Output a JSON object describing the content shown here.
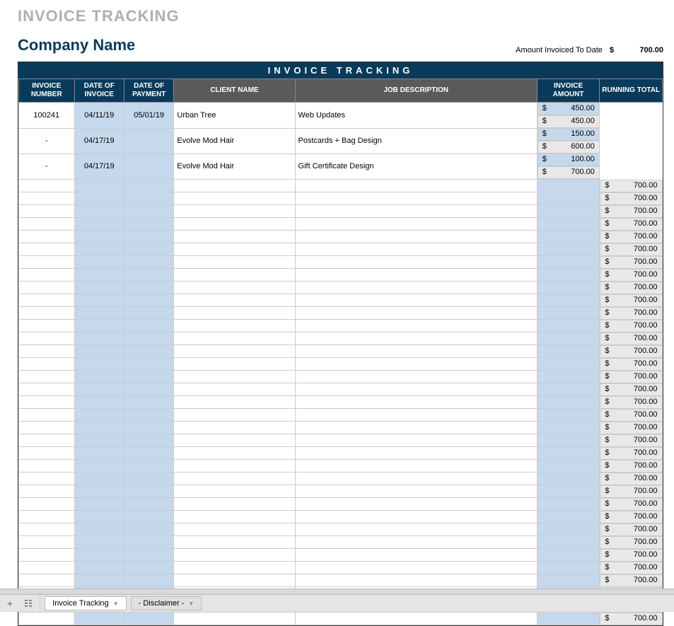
{
  "title": "INVOICE TRACKING",
  "company": "Company Name",
  "amount_invoiced_label": "Amount Invoiced To Date",
  "amount_currency": "$",
  "amount_value": "700.00",
  "banner": "INVOICE  TRACKING",
  "headers": {
    "invnum": "INVOICE NUMBER",
    "dinv": "DATE OF INVOICE",
    "dpay": "DATE OF PAYMENT",
    "client": "CLIENT NAME",
    "job": "JOB DESCRIPTION",
    "amount": "INVOICE AMOUNT",
    "running": "RUNNING TOTAL"
  },
  "rows": [
    {
      "invnum": "100241",
      "dinv": "04/11/19",
      "dpay": "05/01/19",
      "client": "Urban Tree",
      "job": "Web Updates",
      "amount": "450.00",
      "running": "450.00"
    },
    {
      "invnum": "-",
      "dinv": "04/17/19",
      "dpay": "",
      "client": "Evolve Mod Hair",
      "job": "Postcards + Bag Design",
      "amount": "150.00",
      "running": "600.00"
    },
    {
      "invnum": "-",
      "dinv": "04/17/19",
      "dpay": "",
      "client": "Evolve Mod Hair",
      "job": "Gift Certificate Design",
      "amount": "100.00",
      "running": "700.00"
    },
    {
      "invnum": "",
      "dinv": "",
      "dpay": "",
      "client": "",
      "job": "",
      "amount": "",
      "running": "700.00"
    },
    {
      "invnum": "",
      "dinv": "",
      "dpay": "",
      "client": "",
      "job": "",
      "amount": "",
      "running": "700.00"
    },
    {
      "invnum": "",
      "dinv": "",
      "dpay": "",
      "client": "",
      "job": "",
      "amount": "",
      "running": "700.00"
    },
    {
      "invnum": "",
      "dinv": "",
      "dpay": "",
      "client": "",
      "job": "",
      "amount": "",
      "running": "700.00"
    },
    {
      "invnum": "",
      "dinv": "",
      "dpay": "",
      "client": "",
      "job": "",
      "amount": "",
      "running": "700.00"
    },
    {
      "invnum": "",
      "dinv": "",
      "dpay": "",
      "client": "",
      "job": "",
      "amount": "",
      "running": "700.00"
    },
    {
      "invnum": "",
      "dinv": "",
      "dpay": "",
      "client": "",
      "job": "",
      "amount": "",
      "running": "700.00"
    },
    {
      "invnum": "",
      "dinv": "",
      "dpay": "",
      "client": "",
      "job": "",
      "amount": "",
      "running": "700.00"
    },
    {
      "invnum": "",
      "dinv": "",
      "dpay": "",
      "client": "",
      "job": "",
      "amount": "",
      "running": "700.00"
    },
    {
      "invnum": "",
      "dinv": "",
      "dpay": "",
      "client": "",
      "job": "",
      "amount": "",
      "running": "700.00"
    },
    {
      "invnum": "",
      "dinv": "",
      "dpay": "",
      "client": "",
      "job": "",
      "amount": "",
      "running": "700.00"
    },
    {
      "invnum": "",
      "dinv": "",
      "dpay": "",
      "client": "",
      "job": "",
      "amount": "",
      "running": "700.00"
    },
    {
      "invnum": "",
      "dinv": "",
      "dpay": "",
      "client": "",
      "job": "",
      "amount": "",
      "running": "700.00"
    },
    {
      "invnum": "",
      "dinv": "",
      "dpay": "",
      "client": "",
      "job": "",
      "amount": "",
      "running": "700.00"
    },
    {
      "invnum": "",
      "dinv": "",
      "dpay": "",
      "client": "",
      "job": "",
      "amount": "",
      "running": "700.00"
    },
    {
      "invnum": "",
      "dinv": "",
      "dpay": "",
      "client": "",
      "job": "",
      "amount": "",
      "running": "700.00"
    },
    {
      "invnum": "",
      "dinv": "",
      "dpay": "",
      "client": "",
      "job": "",
      "amount": "",
      "running": "700.00"
    },
    {
      "invnum": "",
      "dinv": "",
      "dpay": "",
      "client": "",
      "job": "",
      "amount": "",
      "running": "700.00"
    },
    {
      "invnum": "",
      "dinv": "",
      "dpay": "",
      "client": "",
      "job": "",
      "amount": "",
      "running": "700.00"
    },
    {
      "invnum": "",
      "dinv": "",
      "dpay": "",
      "client": "",
      "job": "",
      "amount": "",
      "running": "700.00"
    },
    {
      "invnum": "",
      "dinv": "",
      "dpay": "",
      "client": "",
      "job": "",
      "amount": "",
      "running": "700.00"
    },
    {
      "invnum": "",
      "dinv": "",
      "dpay": "",
      "client": "",
      "job": "",
      "amount": "",
      "running": "700.00"
    },
    {
      "invnum": "",
      "dinv": "",
      "dpay": "",
      "client": "",
      "job": "",
      "amount": "",
      "running": "700.00"
    },
    {
      "invnum": "",
      "dinv": "",
      "dpay": "",
      "client": "",
      "job": "",
      "amount": "",
      "running": "700.00"
    },
    {
      "invnum": "",
      "dinv": "",
      "dpay": "",
      "client": "",
      "job": "",
      "amount": "",
      "running": "700.00"
    },
    {
      "invnum": "",
      "dinv": "",
      "dpay": "",
      "client": "",
      "job": "",
      "amount": "",
      "running": "700.00"
    },
    {
      "invnum": "",
      "dinv": "",
      "dpay": "",
      "client": "",
      "job": "",
      "amount": "",
      "running": "700.00"
    },
    {
      "invnum": "",
      "dinv": "",
      "dpay": "",
      "client": "",
      "job": "",
      "amount": "",
      "running": "700.00"
    },
    {
      "invnum": "",
      "dinv": "",
      "dpay": "",
      "client": "",
      "job": "",
      "amount": "",
      "running": "700.00"
    },
    {
      "invnum": "",
      "dinv": "",
      "dpay": "",
      "client": "",
      "job": "",
      "amount": "",
      "running": "700.00"
    },
    {
      "invnum": "",
      "dinv": "",
      "dpay": "",
      "client": "",
      "job": "",
      "amount": "",
      "running": "700.00"
    },
    {
      "invnum": "",
      "dinv": "",
      "dpay": "",
      "client": "",
      "job": "",
      "amount": "",
      "running": "700.00"
    },
    {
      "invnum": "",
      "dinv": "",
      "dpay": "",
      "client": "",
      "job": "",
      "amount": "",
      "running": "700.00"
    },
    {
      "invnum": "",
      "dinv": "",
      "dpay": "",
      "client": "",
      "job": "",
      "amount": "",
      "running": "700.00"
    },
    {
      "invnum": "",
      "dinv": "",
      "dpay": "",
      "client": "",
      "job": "",
      "amount": "",
      "running": "700.00"
    }
  ],
  "tabs": {
    "tracking": "Invoice Tracking",
    "disclaimer": "- Disclaimer -"
  },
  "currency": "$"
}
